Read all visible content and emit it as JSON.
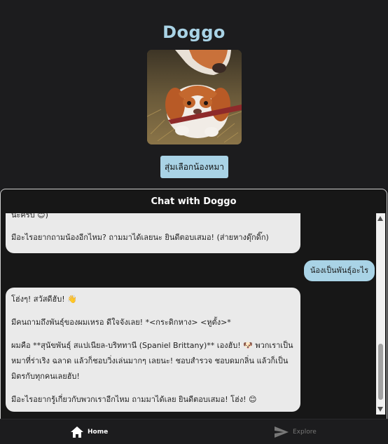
{
  "app": {
    "title": "Doggo",
    "random_button_label": "สุ่มเลือกน้องหมา"
  },
  "chat": {
    "title": "Chat with Doggo",
    "messages": [
      {
        "role": "bot",
        "lines": [
          "นะครับ 😊)",
          "",
          "มีอะไรอยากถามน้องอีกไหม? ถามมาได้เลยนะ ยินดีตอบเสมอ! (ส่ายหางดุ๊กดิ๊ก)"
        ]
      },
      {
        "role": "user",
        "text": "น้องเป็นพันธุ์อะไร"
      },
      {
        "role": "bot",
        "lines": [
          "โฮ่งๆ! สวัสดีฮับ! 👋",
          "",
          "มีคนถามถึงพันธุ์ของผมเหรอ ดีใจจังเลย! *<กระดิกหาง> <หูตั้ง>*",
          "",
          "ผมคือ **สุนัขพันธุ์ สแปเนียล-บริททานี (Spaniel Brittany)** เองฮับ! 🐶 พวกเราเป็น",
          "หมาที่ร่าเริง ฉลาด แล้วก็ชอบวิ่งเล่นมากๆ เลยนะ! ชอบสำรวจ ชอบดมกลิ่น แล้วก็เป็น",
          "มิตรกับทุกคนเลยฮับ!",
          "",
          "มีอะไรอยากรู้เกี่ยวกับพวกเราอีกไหม ถามมาได้เลย ยินดีตอบเสมอ! โฮ่ง! 😊"
        ]
      }
    ]
  },
  "nav": {
    "home_label": "Home",
    "explore_label": "Explore",
    "home_icon": "home-icon",
    "explore_icon": "send-icon"
  },
  "colors": {
    "background": "#1c1c1e",
    "accent": "#a9d3e6",
    "bot_bubble": "#eaeaea"
  }
}
